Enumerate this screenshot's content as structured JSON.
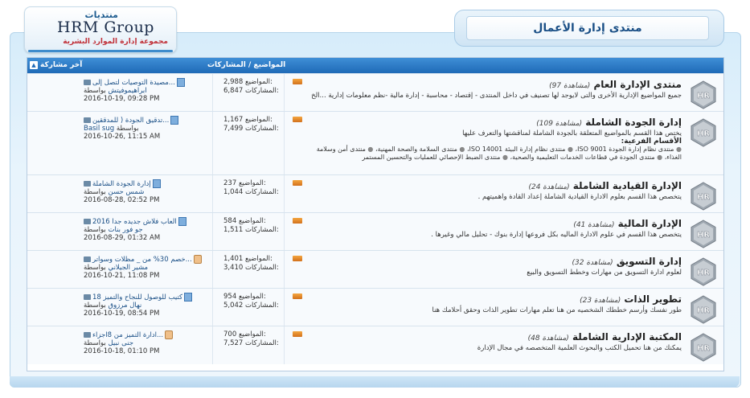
{
  "logo": {
    "line1": "منتديات",
    "line2": "HRM Group",
    "line3": "مجموعة إدارة الموارد البشرية"
  },
  "page_title": "منتدى إدارة الأعمال",
  "header": {
    "col_topics": "المواضيع / المشاركات",
    "col_last": "آخر مشاركة",
    "collapse_icon": "▲"
  },
  "stats_labels": {
    "topics": "المواضيع:",
    "posts": "المشاركات:"
  },
  "colors": {
    "header_blue": "#1f6ab7",
    "link_blue": "#1a4f86",
    "username_red": "#c03038"
  },
  "forums": [
    {
      "title": "منتدى الإدارة العام",
      "views": "(97 مشاهدة)",
      "description": "جميع المواضيع الإدارية الأخرى والتى لايوجد لها تصنيف في داخل المنتدى - إقتصاد - محاسبة - إدارة مالية -نظم معلومات إدارية ...الخ",
      "topics": "2,988",
      "posts": "6,847",
      "last_topic": "مصيدة التوصيات لتصل إلى...",
      "last_icon": "doc",
      "last_by": "بواسطة",
      "last_user": "ابراهيموفيتش",
      "last_date": "2016-10-19, 09:28 PM"
    },
    {
      "title": "إدارة الجودة الشاملة",
      "views": "(109 مشاهدة)",
      "description": "يختص هذا القسم بالمواضيع المتعلقة بالجودة الشاملة لمناقشتها والتعرف عليها",
      "subforums_heading": "الأقسام الفرعية:",
      "subforums": [
        "منتدى نظام إدارة الجودة ISO 9001",
        "منتدى نظام إدارة البيئة ISO 14001",
        "منتدى السلامة والصحة المهنية",
        "منتدى أمن وسلامة الغذاء",
        "منتدى الجودة في قطاعات الخدمات التعليمية والصحية",
        "منتدى الضبط الإحصائي للعمليات والتحسين المستمر"
      ],
      "topics": "1,167",
      "posts": "7,499",
      "last_topic": "تدقيق الجودة ( للمدققين...",
      "last_icon": "doc",
      "last_by": "بواسطة",
      "last_user": "Basil sug",
      "last_date": "2016-10-26, 11:15 AM"
    },
    {
      "title": "الإدارة القيادية الشاملة",
      "views": "(24 مشاهدة)",
      "description": "يتخصص هذا القسم بعلوم الادارة القيادية الشاملة إعداد القادة واهميتهم .",
      "topics": "237",
      "posts": "1,044",
      "last_topic": "إدارة الجودة الشاملة",
      "last_icon": "doc",
      "last_by": "بواسطة",
      "last_user": "شمس حسن",
      "last_date": "2016-08-28, 02:52 PM"
    },
    {
      "title": "الإدارة المالية",
      "views": "(41 مشاهدة)",
      "description": "يتخصص هذا القسم في علوم الادارة الماليه بكل فروعها إدارة بنوك - تحليل مالي وغيرها .",
      "topics": "584",
      "posts": "1,511",
      "last_topic": "العاب فلاش جديده جدا 2016",
      "last_icon": "doc",
      "last_by": "بواسطة",
      "last_user": "جو فور بنات",
      "last_date": "2016-08-29, 01:32 AM"
    },
    {
      "title": "إدارة التسويق",
      "views": "(32 مشاهدة)",
      "description": "لعلوم ادارة التسويق من مهارات وخطط التسويق والبيع",
      "topics": "1,401",
      "posts": "3,410",
      "last_topic": "خصم 30% من _ مظلات وسواتر...",
      "last_icon": "thumb",
      "last_by": "بواسطة",
      "last_user": "مشير الجيلاني",
      "last_date": "2016-10-21, 11:08 PM"
    },
    {
      "title": "تطوير الذات",
      "views": "(23 مشاهدة)",
      "description": "طور نفسك وأرسم خططك الشخصيه من هنا تعلم مهارات تطوير الذات وحقق أحلامك هنا",
      "topics": "954",
      "posts": "5,042",
      "last_topic": "18 كتيب للوصول للنجاح والتميز",
      "last_icon": "doc",
      "last_by": "بواسطة",
      "last_user": "نهال مرزوق",
      "last_date": "2016-10-19, 08:54 PM"
    },
    {
      "title": "المكتبة الإدارية الشاملة",
      "views": "(48 مشاهدة)",
      "description": "يمكنك من هنا تحميل الكتب والبحوث العلمية المتخصصه في مجال الإدارة",
      "topics": "700",
      "posts": "7,527",
      "last_topic": "ادارة التميز من 8اجزاء...",
      "last_icon": "thumb",
      "last_by": "بواسطة",
      "last_user": "جنى نبيل",
      "last_date": "2016-10-18, 01:10 PM"
    }
  ]
}
